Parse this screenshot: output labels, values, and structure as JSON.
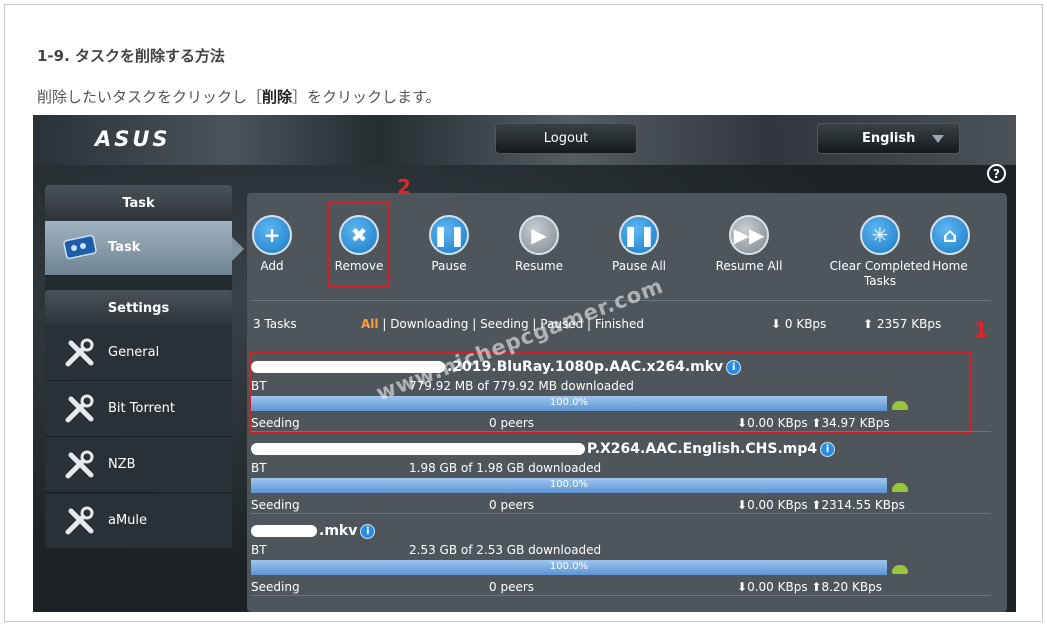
{
  "article": {
    "heading": "1-9. タスクを削除する方法",
    "intro_before": "削除したいタスクをクリックし［",
    "intro_bold": "削除",
    "intro_after": "］をクリックします。"
  },
  "asus": {
    "logo": "ASUS",
    "logout_label": "Logout",
    "language": "English",
    "help": "?",
    "sidebar": {
      "task_header": "Task",
      "task_item": "Task",
      "settings_header": "Settings",
      "items": [
        {
          "label": "General",
          "icon": "wrench-icon"
        },
        {
          "label": "Bit Torrent",
          "icon": "wrench-icon"
        },
        {
          "label": "NZB",
          "icon": "wrench-icon"
        },
        {
          "label": "aMule",
          "icon": "wrench-icon"
        }
      ]
    },
    "toolbar": [
      {
        "label": "Add",
        "icon": "add-icon",
        "style": "blue"
      },
      {
        "label": "Remove",
        "icon": "remove-icon",
        "style": "blue"
      },
      {
        "label": "Pause",
        "icon": "pause-icon",
        "style": "blue"
      },
      {
        "label": "Resume",
        "icon": "play-icon",
        "style": "gray"
      },
      {
        "label": "Pause All",
        "icon": "pause-all-icon",
        "style": "blue"
      },
      {
        "label": "Resume All",
        "icon": "resume-all-icon",
        "style": "gray"
      },
      {
        "label": "Clear Completed Tasks",
        "icon": "clear-icon",
        "style": "blue"
      },
      {
        "label": "Home",
        "icon": "home-icon",
        "style": "blue"
      }
    ],
    "filters": {
      "count": "3 Tasks",
      "all": "All",
      "rest": " | Downloading | Seeding | Paused | Finished",
      "down": "0 KBps",
      "up": "2357 KBps"
    },
    "tasks": [
      {
        "name": ".2019.BluRay.1080p.AAC.x264.mkv",
        "type": "BT",
        "size": "779.92 MB of 779.92 MB downloaded",
        "progress": 1.0,
        "progress_label": "100.0%",
        "state": "Seeding",
        "peers": "0 peers",
        "down": "0.00 KBps",
        "up": "34.97 KBps"
      },
      {
        "name": "P.X264.AAC.English.CHS.mp4",
        "type": "BT",
        "size": "1.98 GB of 1.98 GB downloaded",
        "progress": 1.0,
        "progress_label": "100.0%",
        "state": "Seeding",
        "peers": "0 peers",
        "down": "0.00 KBps",
        "up": "2314.55 KBps"
      },
      {
        "name": ".mkv",
        "type": "BT",
        "size": "2.53 GB of 2.53 GB downloaded",
        "progress": 1.0,
        "progress_label": "100.0%",
        "state": "Seeding",
        "peers": "0 peers",
        "down": "0.00 KBps",
        "up": "8.20 KBps"
      }
    ],
    "callout_1": "1",
    "callout_2": "2",
    "watermark": "www.nichepcgamer.com"
  }
}
